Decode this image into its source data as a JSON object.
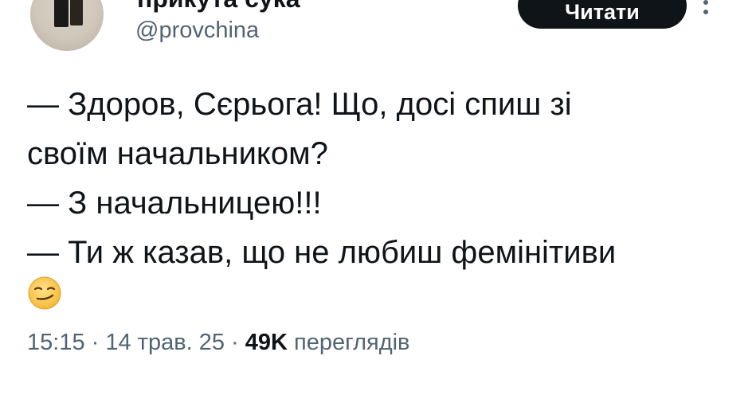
{
  "header": {
    "display_name": "прикута сука",
    "handle": "@provchina",
    "follow_label": "Читати"
  },
  "tweet": {
    "lines": [
      "— Здоров, Сєрьога! Що, досі спиш зі",
      "своїм начальником?",
      "— З начальницею!!!",
      "— Ти ж казав, що не любиш фемінітиви"
    ],
    "emoji": "smirking-face-emoji"
  },
  "meta": {
    "time": "15:15",
    "sep1": " · ",
    "date": "14 трав. 25",
    "sep2": " · ",
    "views_count": "49K",
    "views_label": " переглядів"
  }
}
